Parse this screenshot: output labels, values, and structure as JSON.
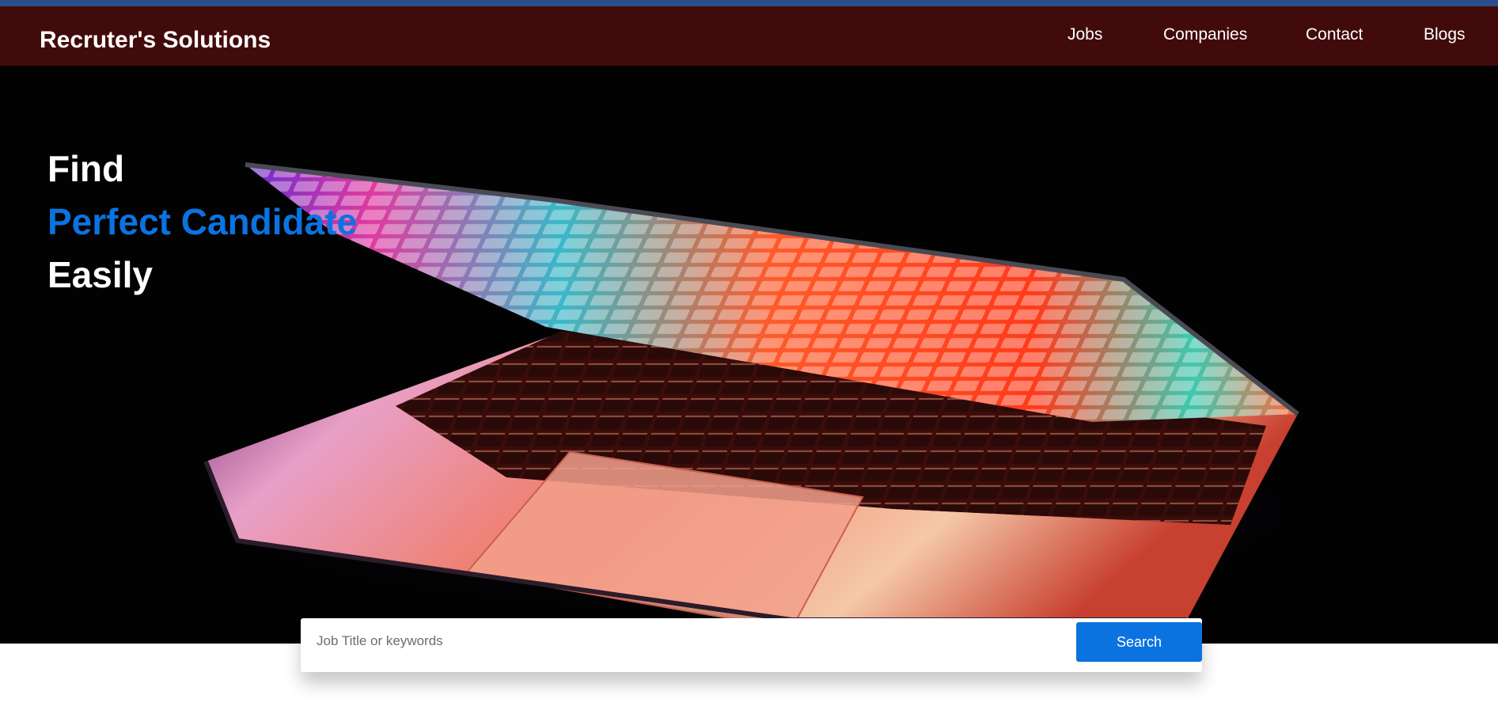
{
  "brand": {
    "name": "Recruter's Solutions"
  },
  "nav": {
    "items": [
      {
        "label": "Jobs"
      },
      {
        "label": "Companies"
      },
      {
        "label": "Contact"
      },
      {
        "label": "Blogs"
      }
    ]
  },
  "hero": {
    "line1": "Find",
    "line2": "Perfect Candidate",
    "line3": "Easily",
    "image": "laptop-photo"
  },
  "search": {
    "placeholder": "Job Title or keywords",
    "value": "",
    "button_label": "Search"
  },
  "colors": {
    "top_strip": "#2a4f8c",
    "navbar": "#420b0b",
    "accent": "#0b73e0",
    "headline_white": "#ffffff",
    "headline_blue": "#0b73e0"
  }
}
